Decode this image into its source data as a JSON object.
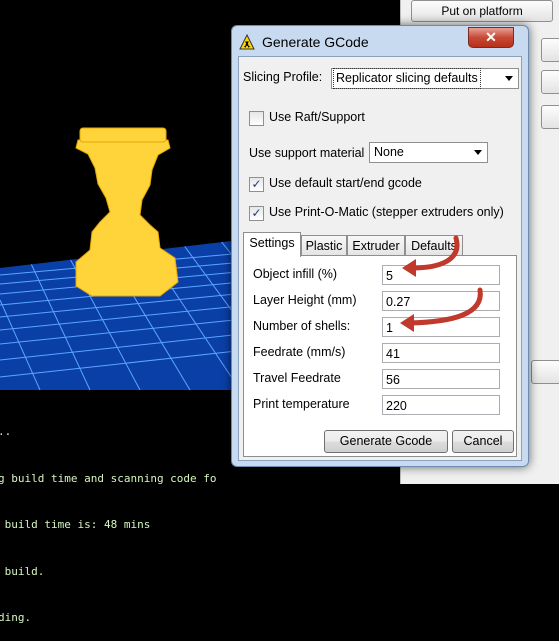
{
  "background_app": {
    "put_on_platform_label": "Put on platform",
    "console_lines": [
      "..",
      "g build time and scanning code fo",
      " build time is: 48 mins",
      " build.",
      "ding."
    ]
  },
  "dialog": {
    "title": "Generate GCode",
    "close_glyph": "✕",
    "slicing_profile_label": "Slicing Profile:",
    "slicing_profile_value": "Replicator slicing defaults",
    "use_raft_label": "Use Raft/Support",
    "use_raft_checked": false,
    "support_material_label": "Use support material",
    "support_material_value": "None",
    "start_end_gcode_label": "Use default start/end gcode",
    "start_end_gcode_checked": true,
    "print_o_matic_label": "Use Print-O-Matic (stepper extruders only)",
    "print_o_matic_checked": true,
    "tabs": [
      "Settings",
      "Plastic",
      "Extruder",
      "Defaults"
    ],
    "active_tab": "Settings",
    "fields": [
      {
        "label": "Object infill (%)",
        "value": "5"
      },
      {
        "label": "Layer Height (mm)",
        "value": "0.27"
      },
      {
        "label": "Number of shells:",
        "value": "1"
      },
      {
        "label": "Feedrate (mm/s)",
        "value": "41"
      },
      {
        "label": "Travel Feedrate",
        "value": "56"
      },
      {
        "label": "Print temperature",
        "value": "220"
      }
    ],
    "generate_button": "Generate Gcode",
    "cancel_button": "Cancel",
    "annotation_color": "#c0392b"
  },
  "colors": {
    "object": "#ffd43a",
    "grid": "#1d6fe0",
    "dialog_frame": "#c8daf0"
  },
  "icons": {
    "title_icon": "warning-radiation-icon",
    "checkbox_mark": "✓"
  }
}
